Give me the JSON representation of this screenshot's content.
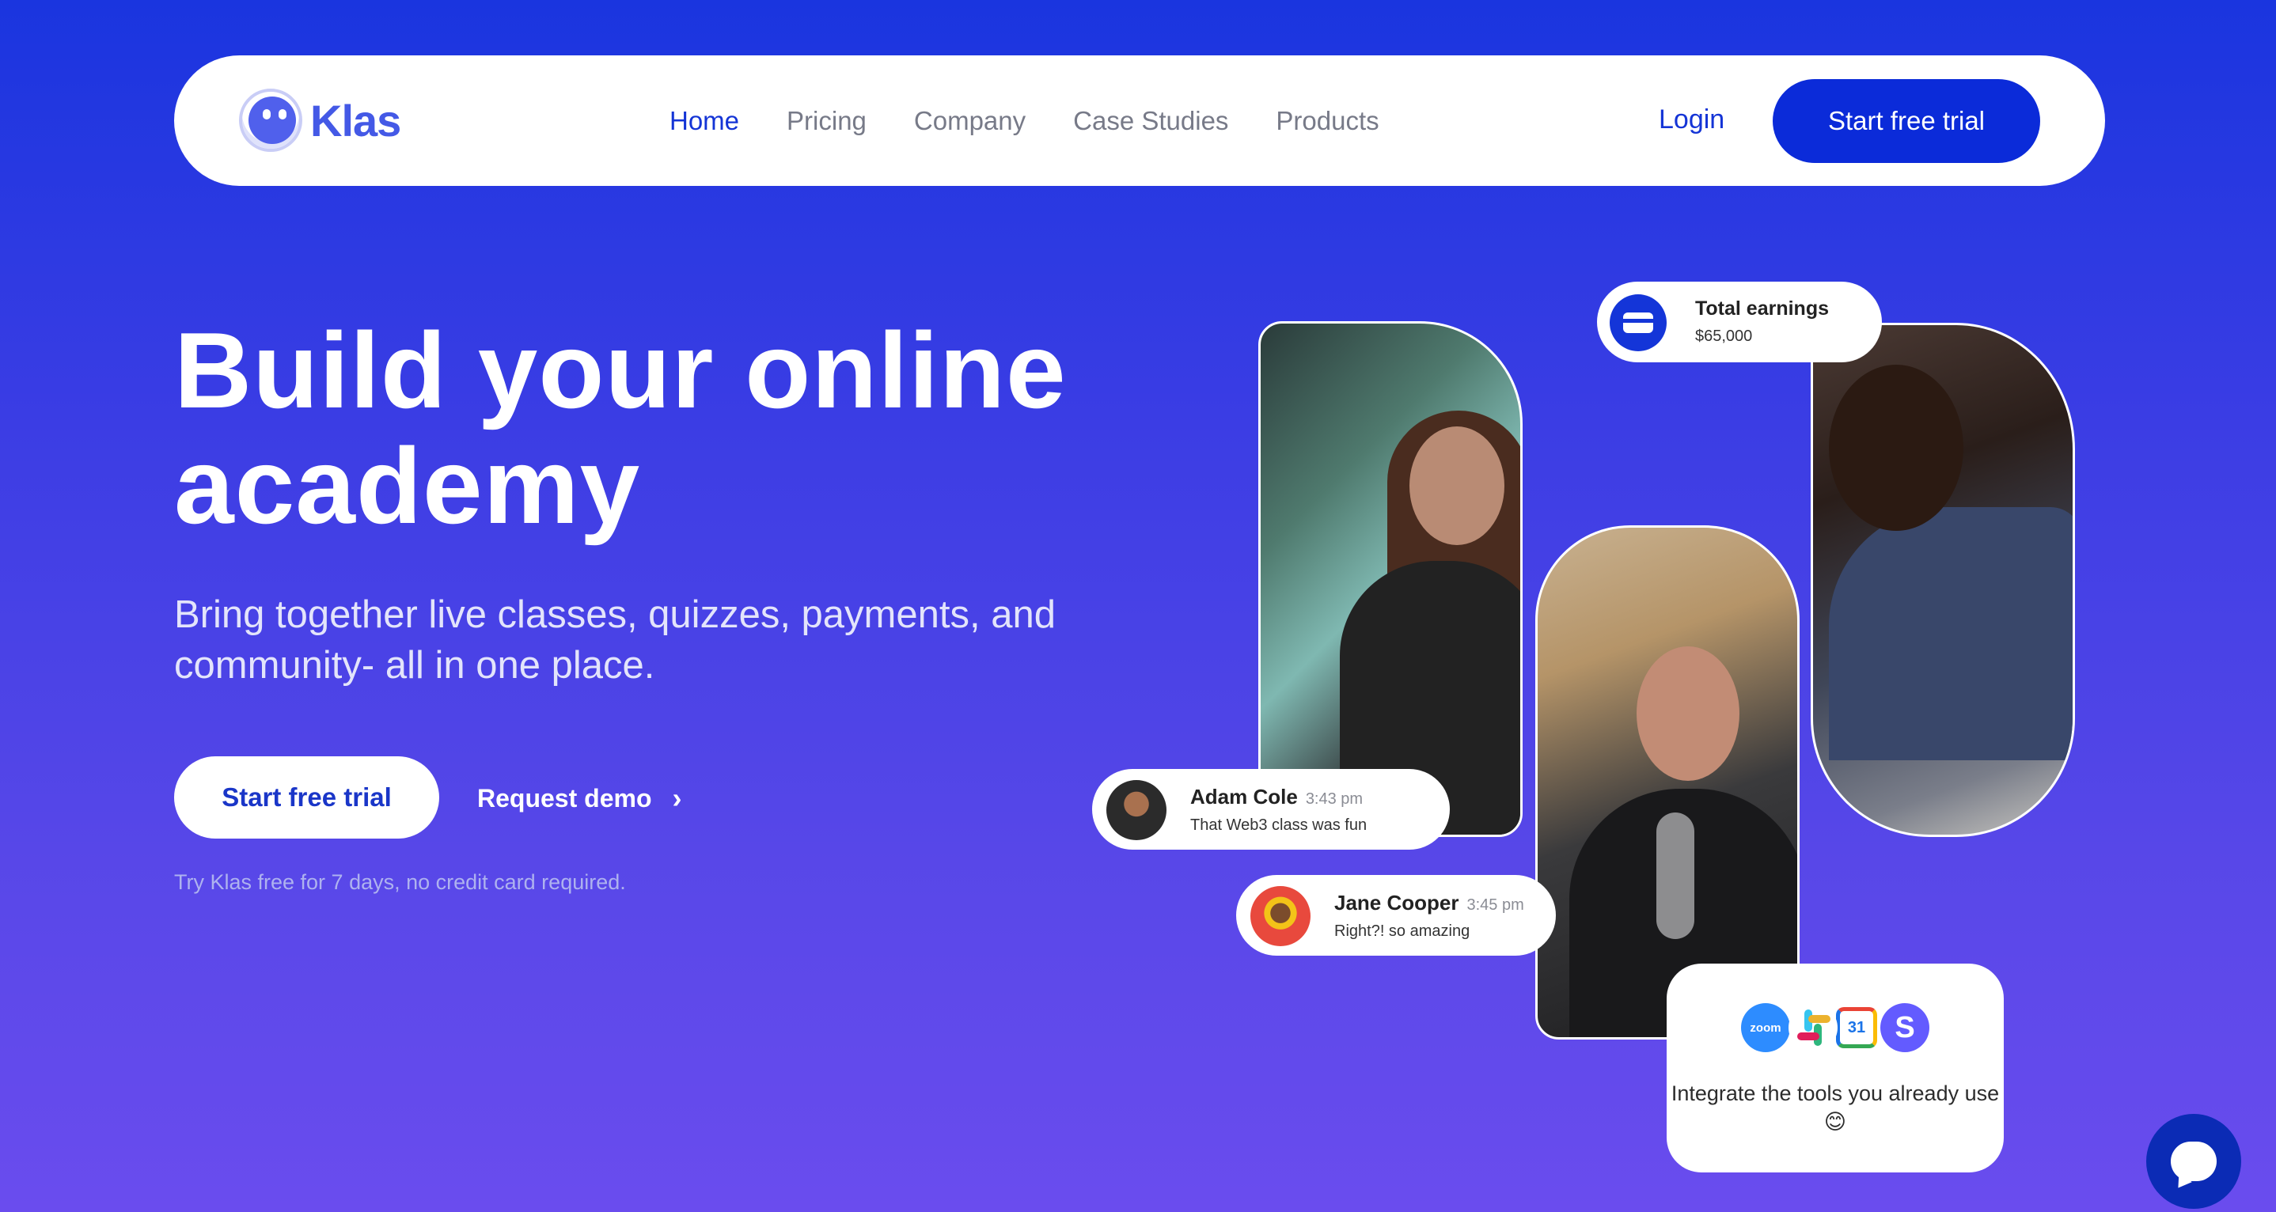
{
  "nav": {
    "logo_text": "Klas",
    "links": [
      {
        "label": "Home",
        "active": true
      },
      {
        "label": "Pricing"
      },
      {
        "label": "Company"
      },
      {
        "label": "Case Studies"
      },
      {
        "label": "Products"
      }
    ],
    "login_label": "Login",
    "cta_label": "Start free trial"
  },
  "hero": {
    "title_line1": "Build your online",
    "title_line2": "academy",
    "subtitle": "Bring together live classes, quizzes, payments, and community- all in one place.",
    "primary_cta": "Start free trial",
    "secondary_cta": "Request demo",
    "hint": "Try Klas free for 7 days, no credit card required."
  },
  "earnings": {
    "title": "Total earnings",
    "value": "$65,000",
    "icon": "wallet-icon"
  },
  "chats": [
    {
      "name": "Adam Cole",
      "time": "3:43 pm",
      "message": "That Web3 class was fun"
    },
    {
      "name": "Jane Cooper",
      "time": "3:45 pm",
      "message": "Right?! so amazing"
    }
  ],
  "integrations": {
    "tools": [
      "zoom",
      "slack",
      "google-calendar",
      "stripe"
    ],
    "zoom_label": "zoom",
    "calendar_label": "31",
    "stripe_label": "S",
    "text": "Integrate the tools you already use 😊"
  },
  "colors": {
    "accent": "#0b2bd9",
    "background_top": "#1a35df",
    "background_bottom": "#6a4cee"
  }
}
